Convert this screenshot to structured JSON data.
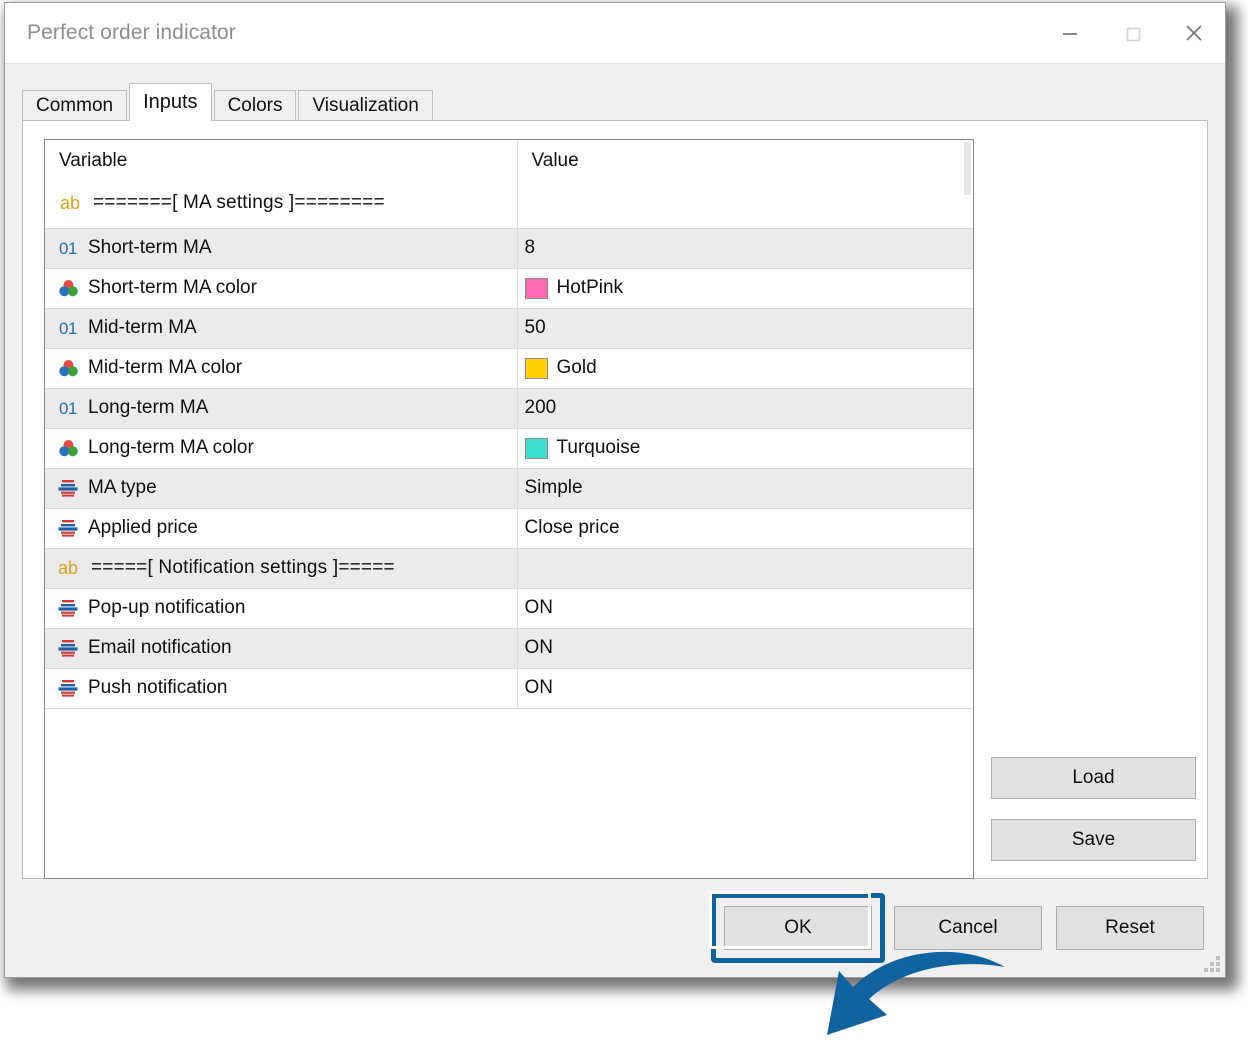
{
  "window": {
    "title": "Perfect order indicator",
    "controls": [
      {
        "name": "minimize",
        "glyph": "minimize-icon"
      },
      {
        "name": "maximize",
        "glyph": "maximize-icon"
      },
      {
        "name": "close",
        "glyph": "close-icon"
      }
    ]
  },
  "tabs": [
    {
      "label": "Common",
      "active": false
    },
    {
      "label": "Inputs",
      "active": true
    },
    {
      "label": "Colors",
      "active": false
    },
    {
      "label": "Visualization",
      "active": false
    }
  ],
  "table": {
    "headers": {
      "variable": "Variable",
      "value": "Value"
    },
    "section_header_row": {
      "icon": "ab",
      "variable": "=======[  MA settings  ]========",
      "value": ""
    },
    "rows": [
      {
        "icon": "01",
        "variable": "Short-term MA",
        "value": "8",
        "swatch": null
      },
      {
        "icon": "color",
        "variable": "Short-term MA color",
        "value": "HotPink",
        "swatch": "#FF69B4"
      },
      {
        "icon": "01",
        "variable": "Mid-term MA",
        "value": "50",
        "swatch": null
      },
      {
        "icon": "color",
        "variable": "Mid-term MA color",
        "value": "Gold",
        "swatch": "#FFD200"
      },
      {
        "icon": "01",
        "variable": "Long-term MA",
        "value": "200",
        "swatch": null
      },
      {
        "icon": "color",
        "variable": "Long-term MA color",
        "value": "Turquoise",
        "swatch": "#40E0D0"
      },
      {
        "icon": "enum",
        "variable": "MA type",
        "value": "Simple",
        "swatch": null
      },
      {
        "icon": "enum",
        "variable": "Applied price",
        "value": "Close price",
        "swatch": null
      },
      {
        "icon": "ab",
        "variable": "=====[  Notification settings  ]=====",
        "value": "",
        "swatch": null
      },
      {
        "icon": "enum",
        "variable": "Pop-up notification",
        "value": "ON",
        "swatch": null
      },
      {
        "icon": "enum",
        "variable": "Email notification",
        "value": "ON",
        "swatch": null
      },
      {
        "icon": "enum",
        "variable": "Push notification",
        "value": "ON",
        "swatch": null
      }
    ]
  },
  "side_buttons": {
    "load": "Load",
    "save": "Save"
  },
  "actions": {
    "ok": "OK",
    "cancel": "Cancel",
    "reset": "Reset"
  },
  "annotation": {
    "highlight_color": "#10639E",
    "arrow_color": "#10639E",
    "target": "OK"
  }
}
